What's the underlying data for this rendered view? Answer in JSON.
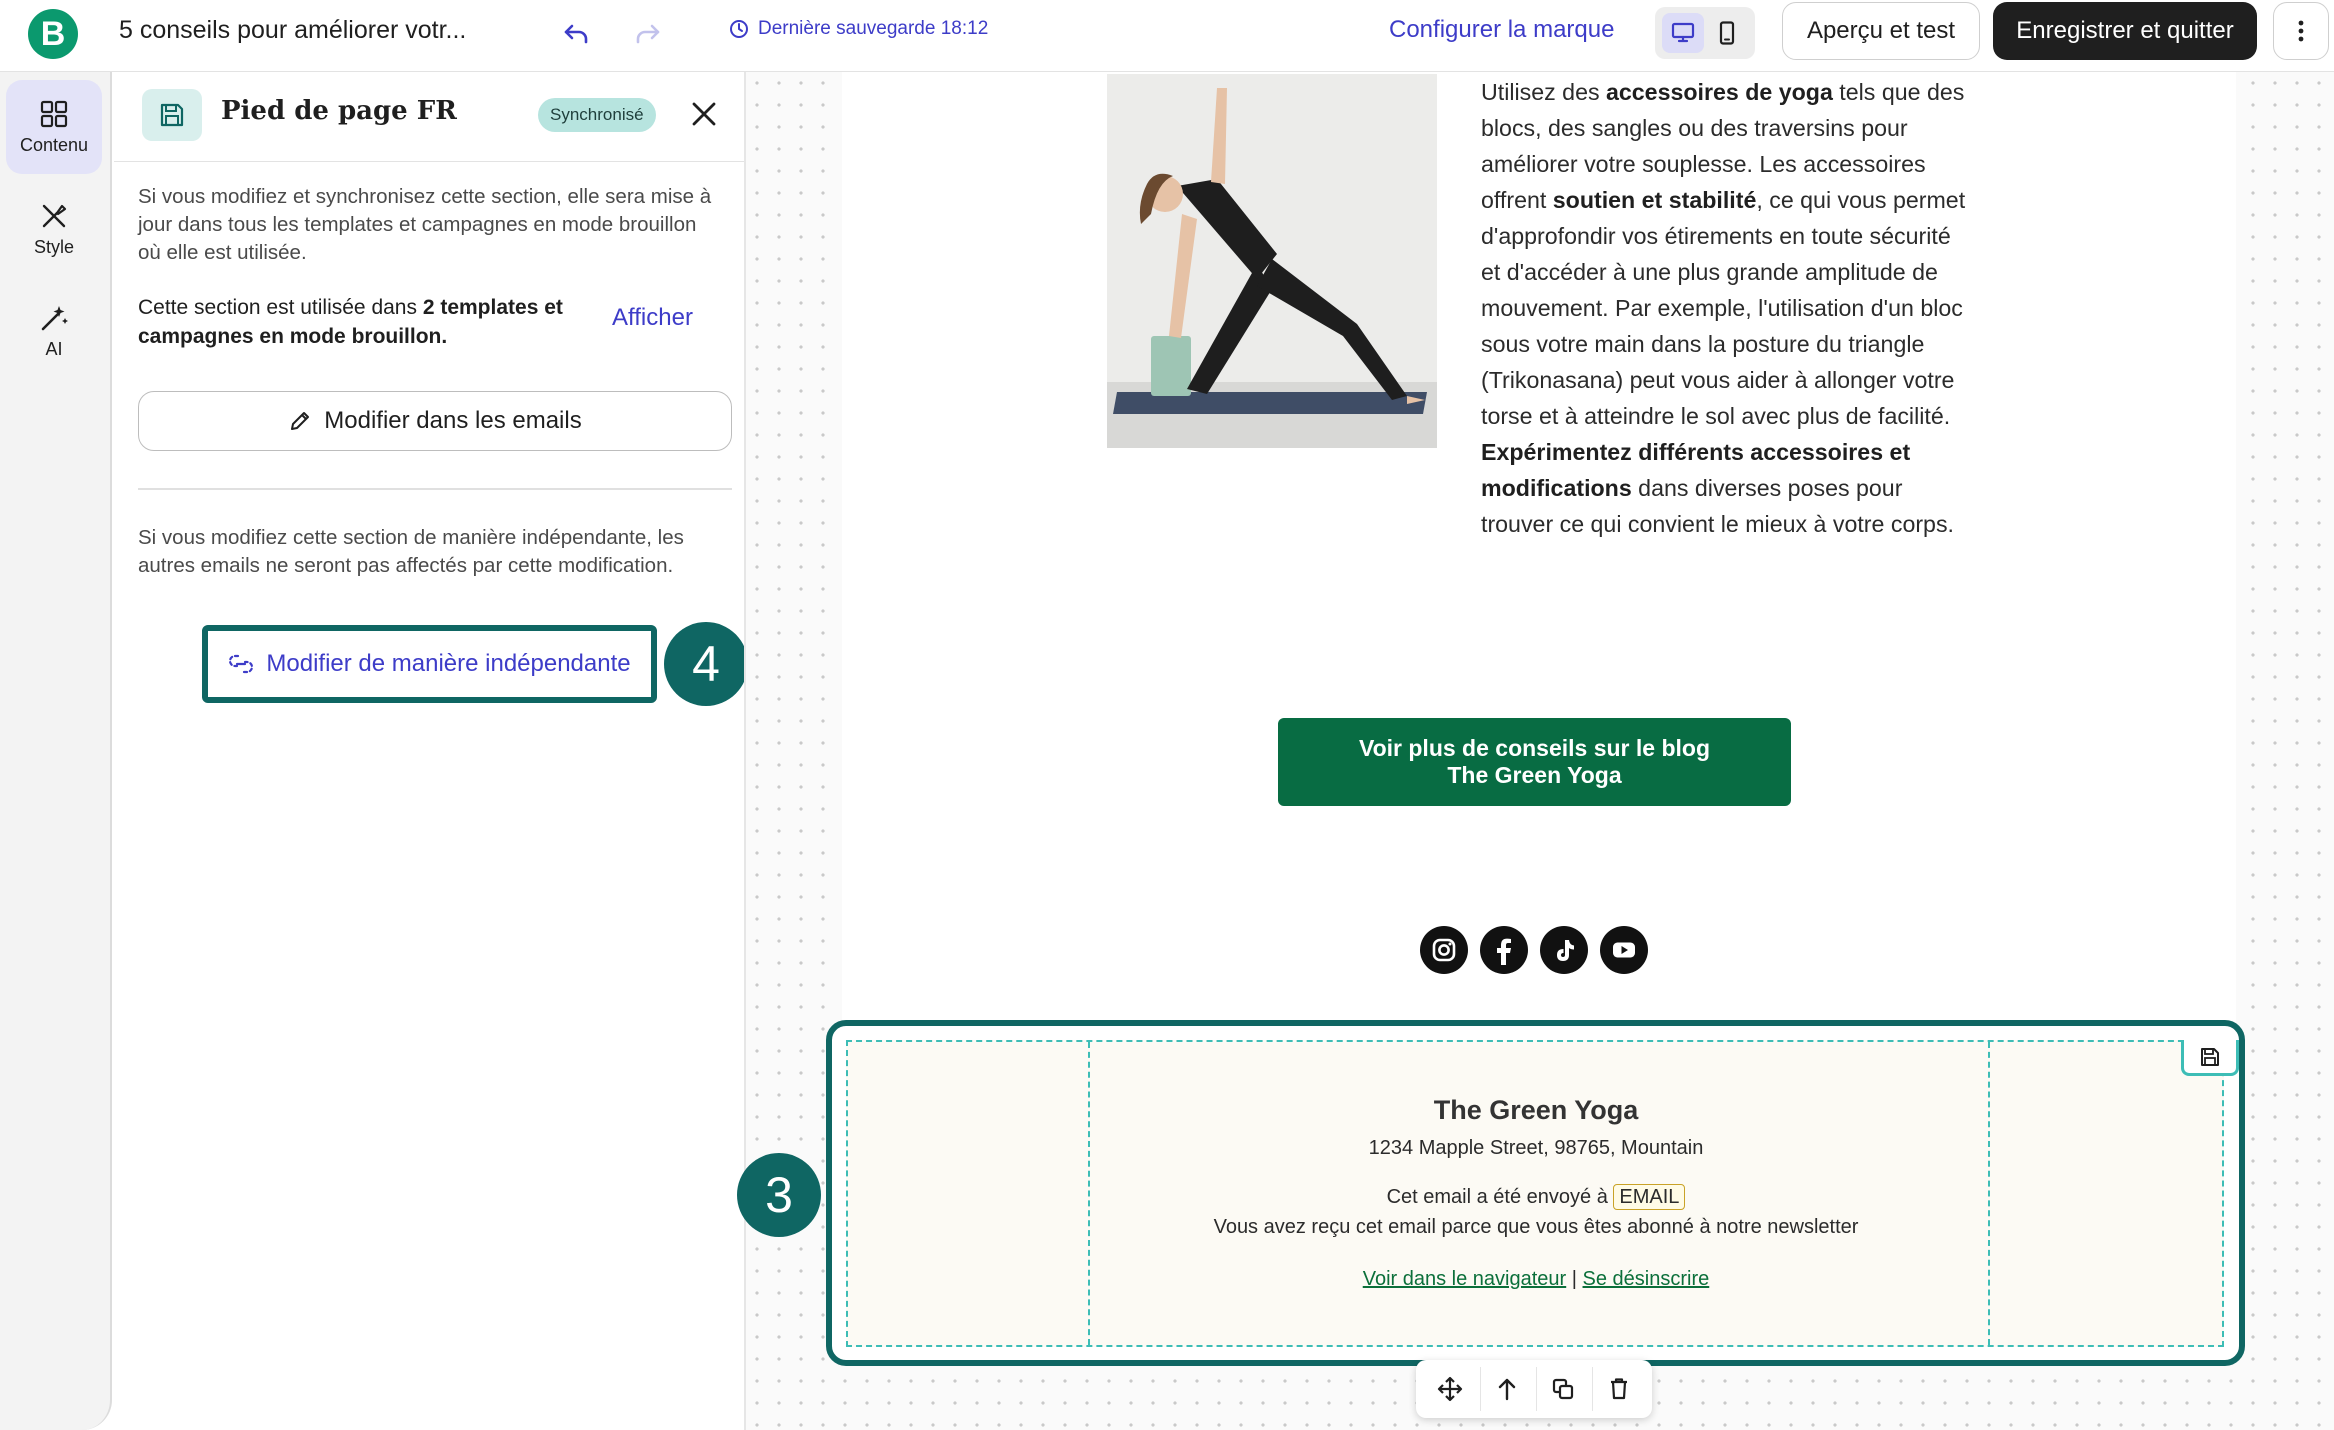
{
  "app": {
    "logo_letter": "B",
    "brand_color": "#0b996e"
  },
  "topbar": {
    "document_title": "5 conseils pour améliorer votr...",
    "last_saved": "Dernière sauvegarde 18:12",
    "configure_brand": "Configurer la marque",
    "preview_button": "Aperçu et test",
    "save_quit_button": "Enregistrer et quitter",
    "active_device": "desktop"
  },
  "rail": {
    "items": [
      {
        "label": "Contenu",
        "icon": "grid-icon",
        "active": true
      },
      {
        "label": "Style",
        "icon": "brush-icon",
        "active": false
      },
      {
        "label": "AI",
        "icon": "magic-wand-icon",
        "active": false
      }
    ]
  },
  "panel": {
    "title": "Pied de page FR",
    "badge": "Synchronisé",
    "sync_info": "Si vous modifiez et synchronisez cette section, elle sera mise à jour dans tous les templates et campagnes en mode brouillon où elle est utilisée.",
    "usage_prefix": "Cette section est utilisée dans ",
    "usage_bold": "2 templates et campagnes en mode brouillon.",
    "show_link": "Afficher",
    "modify_emails_button": "Modifier dans les emails",
    "independent_info": "Si vous modifiez cette section de manière indépendante, les autres emails ne seront pas affectés par cette modification.",
    "independent_button": "Modifier de manière indépendante",
    "step_badge": "4"
  },
  "email": {
    "body_segments": [
      {
        "text": "Utilisez des ",
        "bold": false
      },
      {
        "text": "accessoires de yoga",
        "bold": true
      },
      {
        "text": " tels que des blocs, des sangles ou des traversins pour améliorer votre souplesse. Les accessoires offrent ",
        "bold": false
      },
      {
        "text": "soutien et stabilité",
        "bold": true
      },
      {
        "text": ", ce qui vous permet d'approfondir vos étirements en toute sécurité et d'accéder à une plus grande amplitude de mouvement. Par exemple, l'utilisation d'un bloc sous votre main dans la posture du triangle (Trikonasana) peut vous aider à allonger votre torse et à atteindre le sol avec plus de facilité. ",
        "bold": false
      },
      {
        "text": "Expérimentez différents accessoires et modifications",
        "bold": true
      },
      {
        "text": " dans diverses poses pour trouver ce qui convient le mieux à votre corps.",
        "bold": false
      }
    ],
    "cta_line1": "Voir plus de conseils sur le blog",
    "cta_line2": "The Green Yoga",
    "cta_color": "#086c43",
    "socials": [
      "instagram-icon",
      "facebook-icon",
      "tiktok-icon",
      "youtube-icon"
    ]
  },
  "footer": {
    "step_badge": "3",
    "company": "The Green Yoga",
    "address": "1234 Mapple Street, 98765, Mountain",
    "sent_to": "Cet email a été envoyé à",
    "email_tag": "EMAIL",
    "reason": "Vous avez reçu cet email parce que vous êtes abonné à notre newsletter",
    "view_in_browser": "Voir dans le navigateur",
    "separator": "|",
    "unsubscribe": "Se désinscrire",
    "highlight_color": "#0f6663"
  }
}
